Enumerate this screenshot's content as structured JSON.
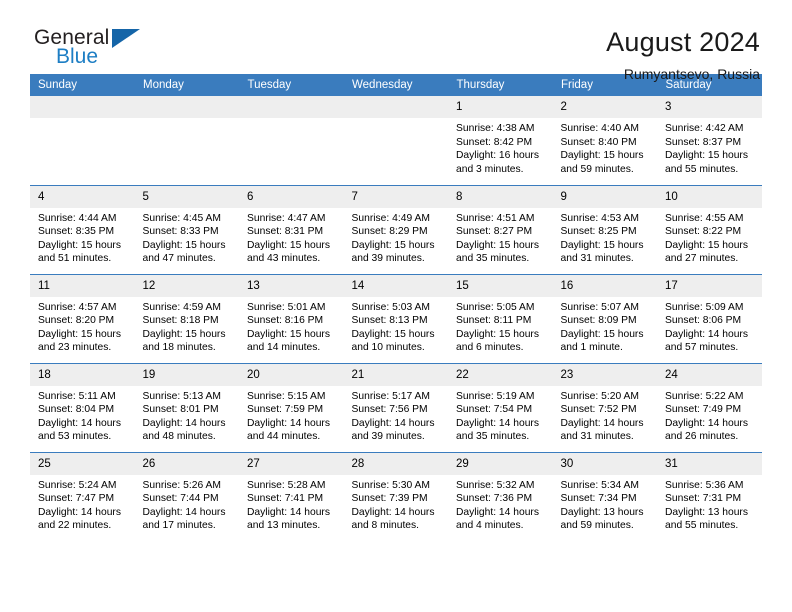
{
  "brand": {
    "name_part1": "General",
    "name_part2": "Blue",
    "triangle_icon": "blue-triangle-logo-mark",
    "color_dark": "#231f20",
    "color_blue": "#1d7ec4"
  },
  "header": {
    "title": "August 2024",
    "location": "Rumyantsevo, Russia"
  },
  "calendar": {
    "header_bg": "#3a7cbe",
    "daynum_bg": "#eeeeee",
    "weekdays": [
      "Sunday",
      "Monday",
      "Tuesday",
      "Wednesday",
      "Thursday",
      "Friday",
      "Saturday"
    ],
    "weeks": [
      [
        {
          "day": "",
          "empty": true
        },
        {
          "day": "",
          "empty": true
        },
        {
          "day": "",
          "empty": true
        },
        {
          "day": "",
          "empty": true
        },
        {
          "day": "1",
          "sunrise": "Sunrise: 4:38 AM",
          "sunset": "Sunset: 8:42 PM",
          "daylight": "Daylight: 16 hours and 3 minutes."
        },
        {
          "day": "2",
          "sunrise": "Sunrise: 4:40 AM",
          "sunset": "Sunset: 8:40 PM",
          "daylight": "Daylight: 15 hours and 59 minutes."
        },
        {
          "day": "3",
          "sunrise": "Sunrise: 4:42 AM",
          "sunset": "Sunset: 8:37 PM",
          "daylight": "Daylight: 15 hours and 55 minutes."
        }
      ],
      [
        {
          "day": "4",
          "sunrise": "Sunrise: 4:44 AM",
          "sunset": "Sunset: 8:35 PM",
          "daylight": "Daylight: 15 hours and 51 minutes."
        },
        {
          "day": "5",
          "sunrise": "Sunrise: 4:45 AM",
          "sunset": "Sunset: 8:33 PM",
          "daylight": "Daylight: 15 hours and 47 minutes."
        },
        {
          "day": "6",
          "sunrise": "Sunrise: 4:47 AM",
          "sunset": "Sunset: 8:31 PM",
          "daylight": "Daylight: 15 hours and 43 minutes."
        },
        {
          "day": "7",
          "sunrise": "Sunrise: 4:49 AM",
          "sunset": "Sunset: 8:29 PM",
          "daylight": "Daylight: 15 hours and 39 minutes."
        },
        {
          "day": "8",
          "sunrise": "Sunrise: 4:51 AM",
          "sunset": "Sunset: 8:27 PM",
          "daylight": "Daylight: 15 hours and 35 minutes."
        },
        {
          "day": "9",
          "sunrise": "Sunrise: 4:53 AM",
          "sunset": "Sunset: 8:25 PM",
          "daylight": "Daylight: 15 hours and 31 minutes."
        },
        {
          "day": "10",
          "sunrise": "Sunrise: 4:55 AM",
          "sunset": "Sunset: 8:22 PM",
          "daylight": "Daylight: 15 hours and 27 minutes."
        }
      ],
      [
        {
          "day": "11",
          "sunrise": "Sunrise: 4:57 AM",
          "sunset": "Sunset: 8:20 PM",
          "daylight": "Daylight: 15 hours and 23 minutes."
        },
        {
          "day": "12",
          "sunrise": "Sunrise: 4:59 AM",
          "sunset": "Sunset: 8:18 PM",
          "daylight": "Daylight: 15 hours and 18 minutes."
        },
        {
          "day": "13",
          "sunrise": "Sunrise: 5:01 AM",
          "sunset": "Sunset: 8:16 PM",
          "daylight": "Daylight: 15 hours and 14 minutes."
        },
        {
          "day": "14",
          "sunrise": "Sunrise: 5:03 AM",
          "sunset": "Sunset: 8:13 PM",
          "daylight": "Daylight: 15 hours and 10 minutes."
        },
        {
          "day": "15",
          "sunrise": "Sunrise: 5:05 AM",
          "sunset": "Sunset: 8:11 PM",
          "daylight": "Daylight: 15 hours and 6 minutes."
        },
        {
          "day": "16",
          "sunrise": "Sunrise: 5:07 AM",
          "sunset": "Sunset: 8:09 PM",
          "daylight": "Daylight: 15 hours and 1 minute."
        },
        {
          "day": "17",
          "sunrise": "Sunrise: 5:09 AM",
          "sunset": "Sunset: 8:06 PM",
          "daylight": "Daylight: 14 hours and 57 minutes."
        }
      ],
      [
        {
          "day": "18",
          "sunrise": "Sunrise: 5:11 AM",
          "sunset": "Sunset: 8:04 PM",
          "daylight": "Daylight: 14 hours and 53 minutes."
        },
        {
          "day": "19",
          "sunrise": "Sunrise: 5:13 AM",
          "sunset": "Sunset: 8:01 PM",
          "daylight": "Daylight: 14 hours and 48 minutes."
        },
        {
          "day": "20",
          "sunrise": "Sunrise: 5:15 AM",
          "sunset": "Sunset: 7:59 PM",
          "daylight": "Daylight: 14 hours and 44 minutes."
        },
        {
          "day": "21",
          "sunrise": "Sunrise: 5:17 AM",
          "sunset": "Sunset: 7:56 PM",
          "daylight": "Daylight: 14 hours and 39 minutes."
        },
        {
          "day": "22",
          "sunrise": "Sunrise: 5:19 AM",
          "sunset": "Sunset: 7:54 PM",
          "daylight": "Daylight: 14 hours and 35 minutes."
        },
        {
          "day": "23",
          "sunrise": "Sunrise: 5:20 AM",
          "sunset": "Sunset: 7:52 PM",
          "daylight": "Daylight: 14 hours and 31 minutes."
        },
        {
          "day": "24",
          "sunrise": "Sunrise: 5:22 AM",
          "sunset": "Sunset: 7:49 PM",
          "daylight": "Daylight: 14 hours and 26 minutes."
        }
      ],
      [
        {
          "day": "25",
          "sunrise": "Sunrise: 5:24 AM",
          "sunset": "Sunset: 7:47 PM",
          "daylight": "Daylight: 14 hours and 22 minutes."
        },
        {
          "day": "26",
          "sunrise": "Sunrise: 5:26 AM",
          "sunset": "Sunset: 7:44 PM",
          "daylight": "Daylight: 14 hours and 17 minutes."
        },
        {
          "day": "27",
          "sunrise": "Sunrise: 5:28 AM",
          "sunset": "Sunset: 7:41 PM",
          "daylight": "Daylight: 14 hours and 13 minutes."
        },
        {
          "day": "28",
          "sunrise": "Sunrise: 5:30 AM",
          "sunset": "Sunset: 7:39 PM",
          "daylight": "Daylight: 14 hours and 8 minutes."
        },
        {
          "day": "29",
          "sunrise": "Sunrise: 5:32 AM",
          "sunset": "Sunset: 7:36 PM",
          "daylight": "Daylight: 14 hours and 4 minutes."
        },
        {
          "day": "30",
          "sunrise": "Sunrise: 5:34 AM",
          "sunset": "Sunset: 7:34 PM",
          "daylight": "Daylight: 13 hours and 59 minutes."
        },
        {
          "day": "31",
          "sunrise": "Sunrise: 5:36 AM",
          "sunset": "Sunset: 7:31 PM",
          "daylight": "Daylight: 13 hours and 55 minutes."
        }
      ]
    ]
  }
}
